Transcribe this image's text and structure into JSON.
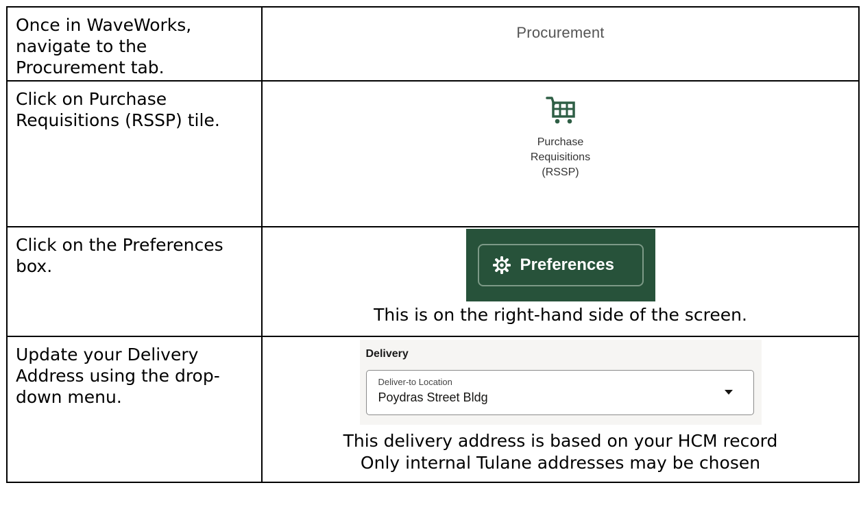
{
  "rows": [
    {
      "instruction": "Once in WaveWorks, navigate to the Procurement tab.",
      "tab_label": "Procurement"
    },
    {
      "instruction": "Click on Purchase Requisitions (RSSP) tile.",
      "tile": {
        "icon": "shopping-cart-icon",
        "label_lines": [
          "Purchase",
          "Requisitions",
          "(RSSP)"
        ]
      }
    },
    {
      "instruction": "Click on the Preferences box.",
      "button": {
        "icon": "gear-icon",
        "label": "Preferences"
      },
      "note": "This is on the right-hand side of the screen."
    },
    {
      "instruction": "Update your Delivery Address using the drop-down menu.",
      "section_title": "Delivery",
      "field": {
        "label": "Deliver-to Location",
        "value": "Poydras Street Bldg",
        "icon": "caret-down-icon"
      },
      "notes": [
        "This delivery address is based on your HCM record",
        "Only internal Tulane addresses may be chosen"
      ]
    }
  ],
  "colors": {
    "brand_green": "#27523a",
    "icon_green": "#2e5e45",
    "panel_bg": "#f6f5f3",
    "border": "#000000"
  }
}
